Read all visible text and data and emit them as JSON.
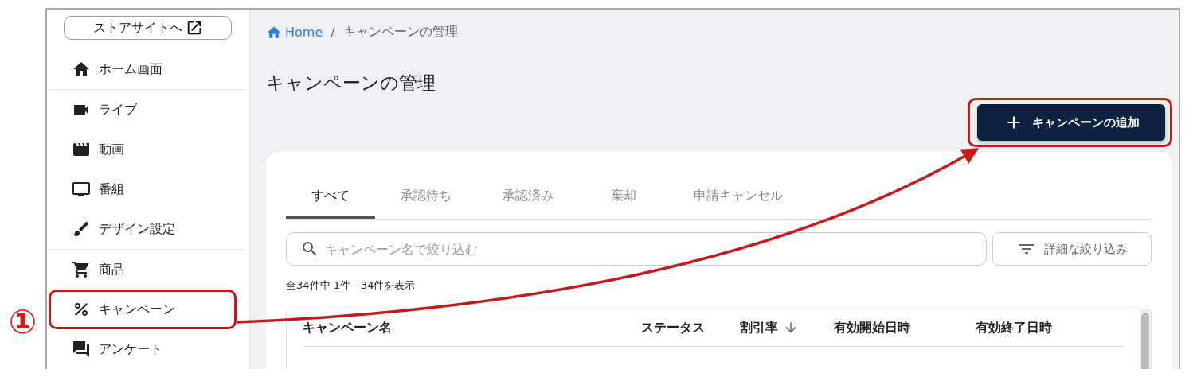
{
  "annotation": {
    "marker": "①"
  },
  "sidebar": {
    "store_button": "ストアサイトへ",
    "groups": [
      [
        {
          "label": "ホーム画面",
          "highlighted": false
        }
      ],
      [
        {
          "label": "ライブ",
          "highlighted": false
        },
        {
          "label": "動画",
          "highlighted": false
        },
        {
          "label": "番組",
          "highlighted": false
        },
        {
          "label": "デザイン設定",
          "highlighted": false
        }
      ],
      [
        {
          "label": "商品",
          "highlighted": false
        },
        {
          "label": "キャンペーン",
          "highlighted": true
        },
        {
          "label": "アンケート",
          "highlighted": false
        }
      ]
    ]
  },
  "breadcrumb": {
    "home": "Home",
    "separator": "/",
    "current": "キャンペーンの管理"
  },
  "title": "キャンペーンの管理",
  "add_button": {
    "label": "キャンペーンの追加",
    "highlighted": true
  },
  "tabs": [
    {
      "label": "すべて",
      "selected": true
    },
    {
      "label": "承認待ち",
      "selected": false
    },
    {
      "label": "承認済み",
      "selected": false
    },
    {
      "label": "棄却",
      "selected": false
    },
    {
      "label": "申請キャンセル",
      "selected": false
    }
  ],
  "search": {
    "placeholder": "キャンペーン名で絞り込む"
  },
  "filter_button": "詳細な絞り込み",
  "count": "全34件中 1件 - 34件を表示",
  "table": {
    "columns": [
      {
        "label": "キャンペーン名",
        "sorted": false
      },
      {
        "label": "ステータス",
        "sorted": false
      },
      {
        "label": "割引率",
        "sorted": true
      },
      {
        "label": "有効開始日時",
        "sorted": false
      },
      {
        "label": "有効終了日時",
        "sorted": false
      }
    ]
  }
}
